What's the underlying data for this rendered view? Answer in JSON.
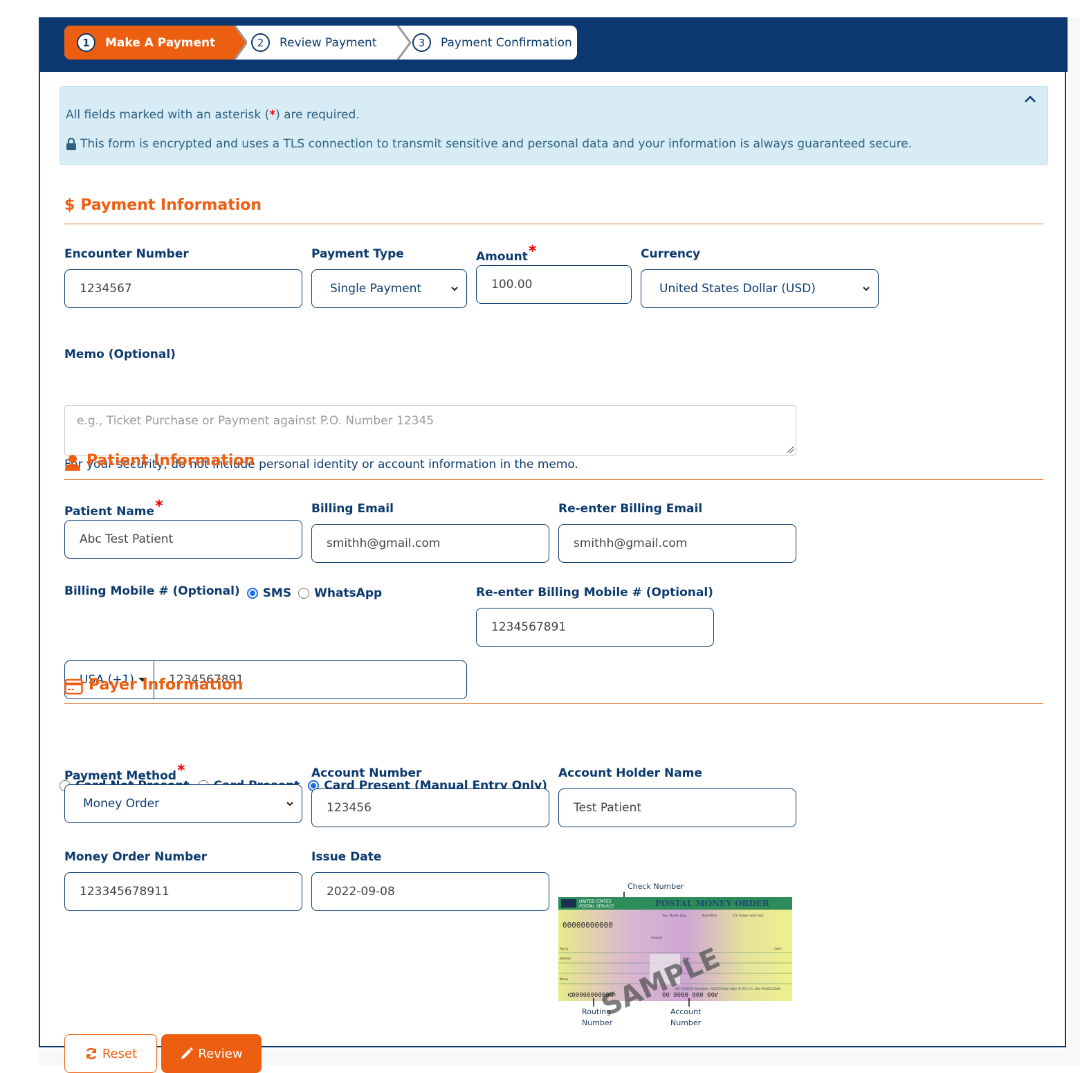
{
  "steps": [
    {
      "number": "1",
      "label": "Make A Payment",
      "active": true
    },
    {
      "number": "2",
      "label": "Review Payment",
      "active": false
    },
    {
      "number": "3",
      "label": "Payment Confirmation",
      "active": false
    }
  ],
  "alert": {
    "required_prefix": "All fields marked with an asterisk (",
    "required_asterisk": "*",
    "required_suffix": ") are required.",
    "security_text": "This form is encrypted and uses a TLS connection to transmit sensitive and personal data and your information is always guaranteed secure.",
    "collapse_icon": "chevron-up-icon"
  },
  "payment_info": {
    "title": "Payment Information",
    "icon": "dollar-icon",
    "icon_glyph": "$",
    "encounter_number": {
      "label": "Encounter Number",
      "value": "1234567"
    },
    "payment_type": {
      "label": "Payment Type",
      "value": "Single Payment"
    },
    "amount": {
      "label": "Amount",
      "required": "*",
      "value": "100.00"
    },
    "currency": {
      "label": "Currency",
      "value": "United States Dollar (USD)"
    },
    "memo": {
      "label": "Memo (Optional)",
      "placeholder": "e.g., Ticket Purchase or Payment against P.O. Number 12345",
      "value": "",
      "helper": "For your security, do not include personal identity or account information in the memo."
    }
  },
  "patient_info": {
    "title": "Patient Information",
    "icon": "user-icon",
    "patient_name": {
      "label": "Patient Name",
      "required": "*",
      "value": "Abc Test Patient"
    },
    "billing_email": {
      "label": "Billing Email",
      "value": "smithh@gmail.com"
    },
    "reenter_billing_email": {
      "label": "Re-enter Billing Email",
      "value": "smithh@gmail.com"
    },
    "billing_mobile": {
      "label": "Billing Mobile # (Optional)",
      "channels": [
        {
          "label": "SMS",
          "selected": true
        },
        {
          "label": "WhatsApp",
          "selected": false
        }
      ],
      "country_code": "USA (+1)",
      "value": "1234567891"
    },
    "reenter_billing_mobile": {
      "label": "Re-enter Billing Mobile # (Optional)",
      "value": "1234567891"
    }
  },
  "payer_info": {
    "title": "Payer Information",
    "icon": "credit-card-icon",
    "card_modes": [
      {
        "label": "Card Not Present",
        "selected": false
      },
      {
        "label": "Card Present",
        "selected": false
      },
      {
        "label": "Card Present (Manual Entry Only)",
        "selected": true
      }
    ],
    "payment_method": {
      "label": "Payment Method",
      "required": "*",
      "value": "Money Order"
    },
    "account_number": {
      "label": "Account Number",
      "value": "123456"
    },
    "account_holder_name": {
      "label": "Account Holder Name",
      "value": "Test Patient"
    },
    "money_order_number": {
      "label": "Money Order Number",
      "value": "123345678911"
    },
    "issue_date": {
      "label": "Issue Date",
      "value": "2022-09-08"
    },
    "sample_image": {
      "check_number_label": "Check Number",
      "routing_number_label_1": "Routing",
      "routing_number_label_2": "Number",
      "account_number_label_1": "Account",
      "account_number_label_2": "Number",
      "header_agency_1": "UNITED STATES",
      "header_agency_2": "POSTAL SERVICE",
      "header_title": "POSTAL MONEY ORDER",
      "watermark": "SAMPLE",
      "serial": "00000000000",
      "routing_digits": "⑆0000000000⑆",
      "account_digits": "00 0000 000 00⑈",
      "field_pay_to": "Pay to",
      "field_address": "Address",
      "field_memo": "Memo",
      "field_from": "From",
      "field_clerk": "Clerk",
      "field_amount": "Amount",
      "col_date": "Year, Month, Day",
      "col_post_office": "Post Office",
      "col_dollars": "U.S. Dollars and Cents",
      "warning": "SEE REVERSE WARNING • NEGOTIABLE ONLY IN THE U.S. AND POSSESSIONS"
    }
  },
  "actions": {
    "reset_label": "Reset",
    "review_label": "Review"
  },
  "colors": {
    "brand_navy": "#0b3870",
    "accent_orange": "#ec5e10",
    "alert_bg": "#d8ecf6",
    "required_red": "#ee0000",
    "radio_blue": "#1a6ee8"
  }
}
